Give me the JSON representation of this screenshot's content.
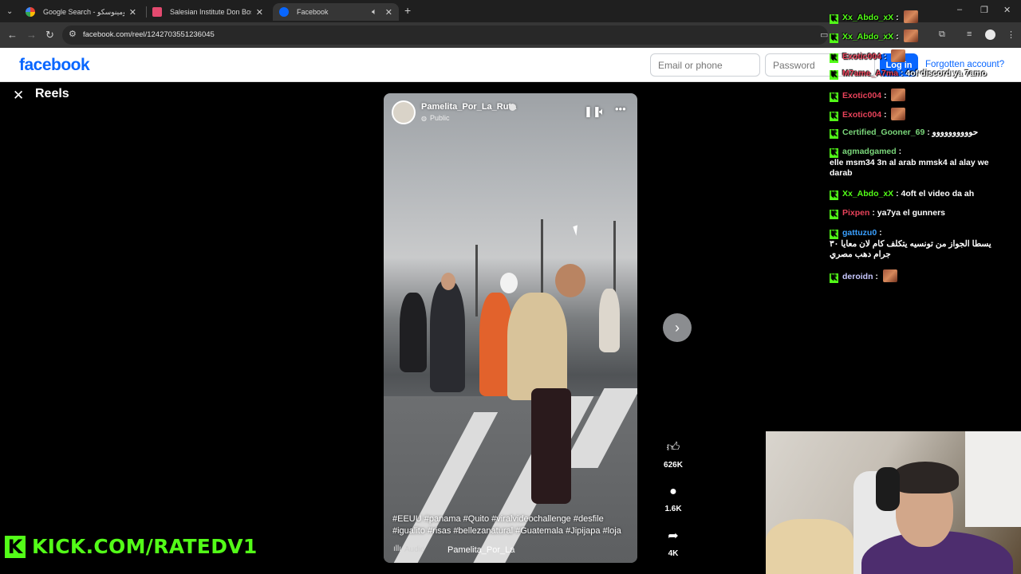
{
  "browser": {
    "tabs": [
      {
        "label": "Google Search - الدومينوسكو",
        "active": false,
        "icon": "google-icon"
      },
      {
        "label": "Salesian Institute Don Bosco",
        "active": false,
        "icon": "site-icon"
      },
      {
        "label": "Facebook",
        "active": true,
        "icon": "facebook-icon"
      }
    ],
    "url": "facebook.com/reel/1242703551236045"
  },
  "facebook": {
    "logo": "facebook",
    "email_placeholder": "Email or phone",
    "password_placeholder": "Password",
    "login_label": "Log in",
    "forgot_label": "Forgotten account?"
  },
  "reels": {
    "title": "Reels",
    "video": {
      "author": "Pamelita_Por_La_Ruta",
      "visibility": "Public",
      "caption": "#EEUU #panama #Quito #viralvideochallenge #desfile #igualito #risas #bellezanatural #Guatemala #Jipijapa #loja",
      "audio_label": "Audio",
      "audio_author": "Pamelita_Por_La"
    },
    "actions": {
      "likes": "626K",
      "comments": "1.6K",
      "shares": "4K"
    }
  },
  "stream": {
    "kick_url": "KICK.COM/RATEDV1",
    "chat": [
      {
        "user": "Xx_Abdo_xX",
        "color": "#53fc18",
        "text": "",
        "emote": true
      },
      {
        "user": "Xx_Abdo_xX",
        "color": "#53fc18",
        "text": "",
        "emote": true
      },
      {
        "user": "Exotic004",
        "color": "#e8425a",
        "text": "",
        "emote": true
      },
      {
        "user": "M7ame_A7ma",
        "color": "#e8425a",
        "text": "4of discord ya 7amo",
        "emote": false
      },
      {
        "user": "Exotic004",
        "color": "#e8425a",
        "text": "",
        "emote": true
      },
      {
        "user": "Exotic004",
        "color": "#e8425a",
        "text": "",
        "emote": true
      },
      {
        "user": "Certified_Gooner_69",
        "color": "#7ad67a",
        "text": "حوووووووووو",
        "emote": false
      },
      {
        "user": "agmadgamed",
        "color": "#7ad67a",
        "text": "elle msm34 3n al arab mmsk4 al alay we darab",
        "emote": false
      },
      {
        "user": "Xx_Abdo_xX",
        "color": "#53fc18",
        "text": "4oft el video da ah",
        "emote": false
      },
      {
        "user": "Pixpen",
        "color": "#e8425a",
        "text": "ya7ya el gunners",
        "emote": false
      },
      {
        "user": "gattuzu0",
        "color": "#3aa0ff",
        "text": "يسطا الجواز من تونسيه يتكلف كام لان معايا ٣٠ جرام دهب مصري",
        "emote": false
      },
      {
        "user": "deroidn",
        "color": "#c8c8ff",
        "text": "",
        "emote": true
      }
    ]
  },
  "colors": {
    "kick_green": "#53fc18",
    "facebook_blue": "#0866ff"
  }
}
